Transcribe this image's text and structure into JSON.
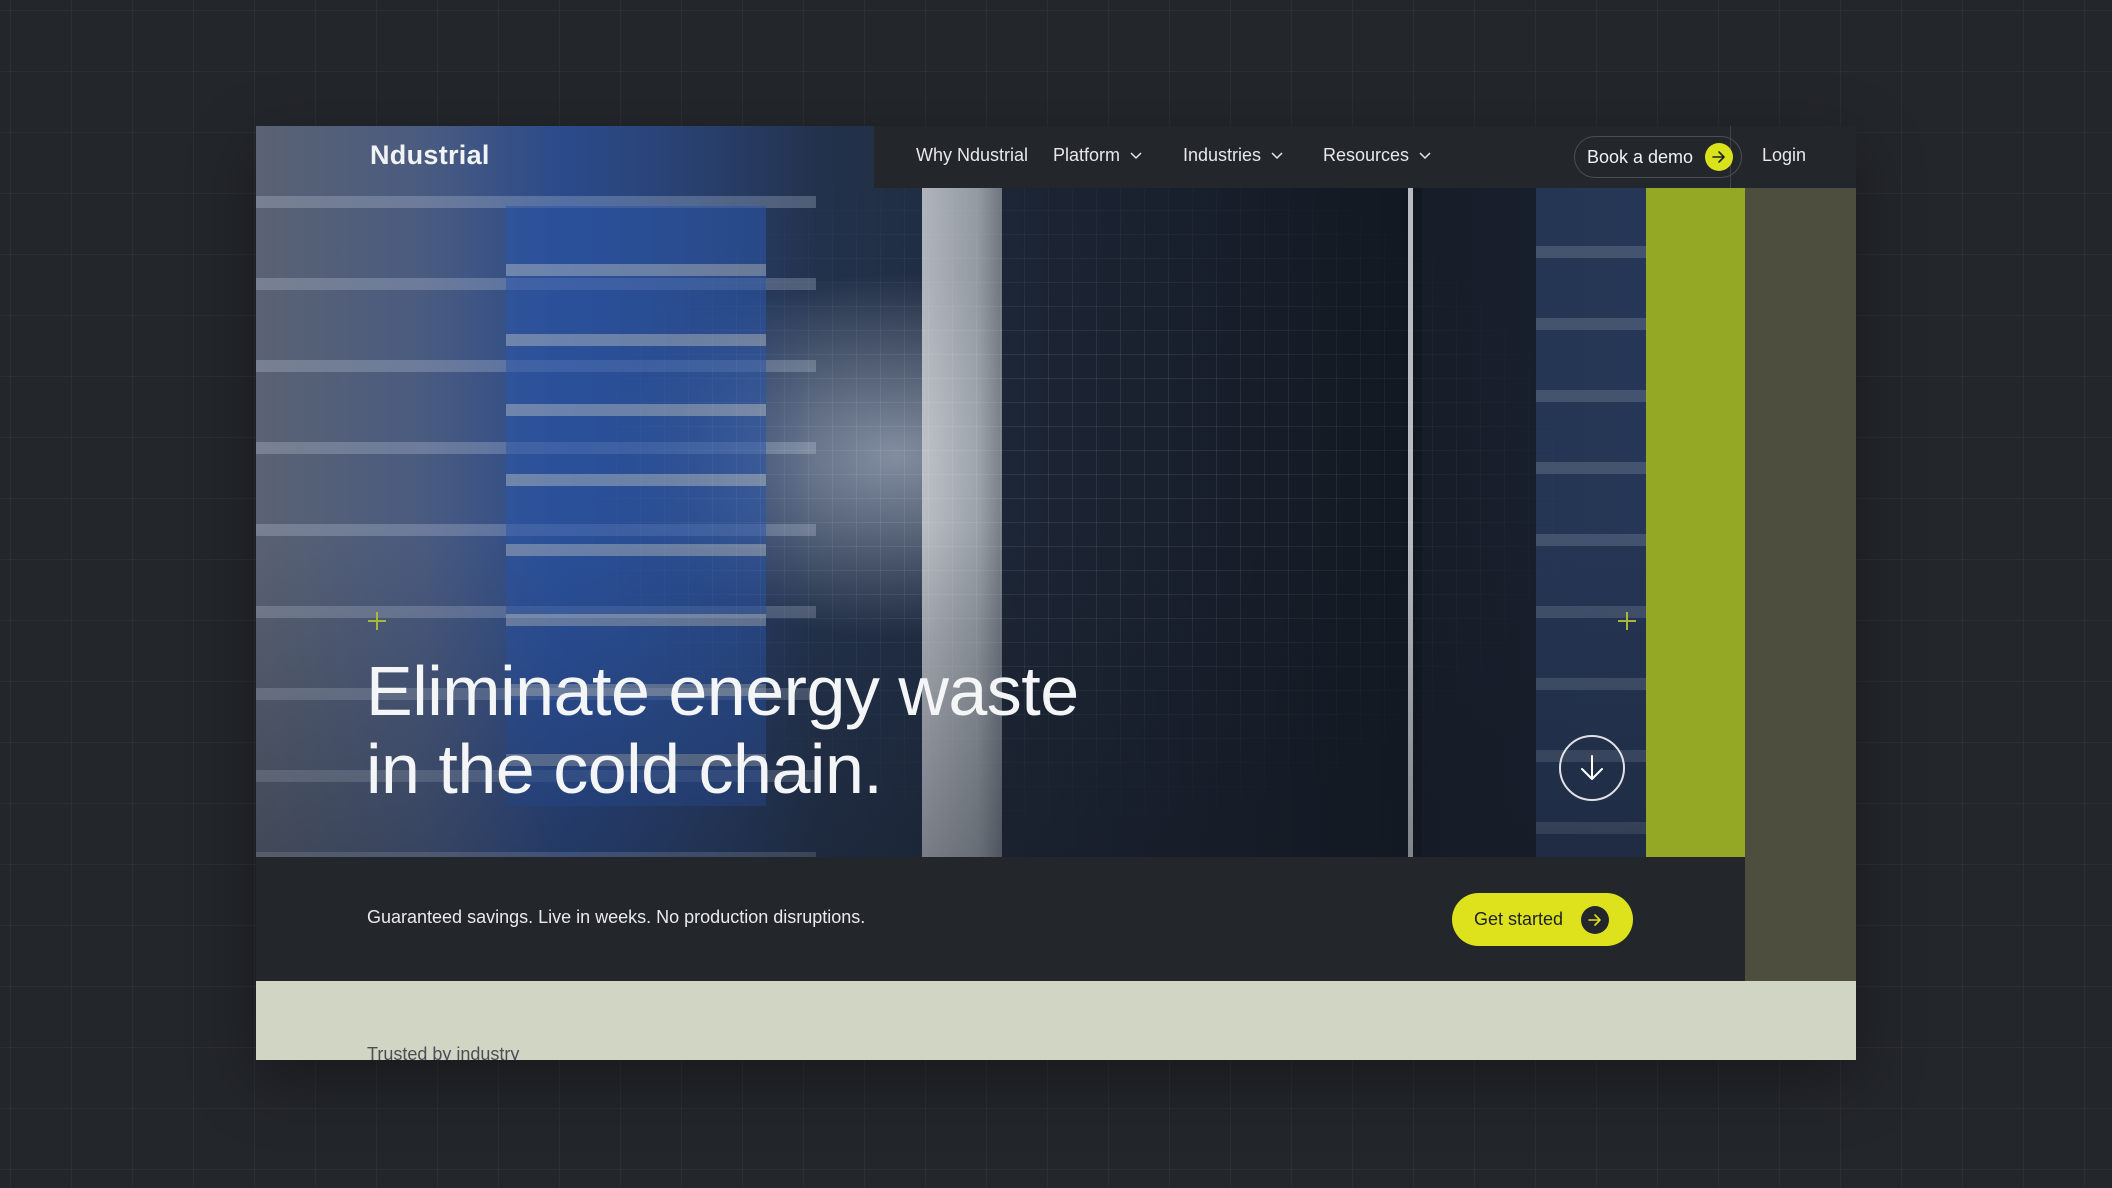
{
  "brand": {
    "logo": "Ndustrial"
  },
  "nav": {
    "items": [
      {
        "label": "Why Ndustrial",
        "has_dropdown": false
      },
      {
        "label": "Platform",
        "has_dropdown": true
      },
      {
        "label": "Industries",
        "has_dropdown": true
      },
      {
        "label": "Resources",
        "has_dropdown": true
      }
    ],
    "login": "Login",
    "cta": "Book a demo"
  },
  "hero": {
    "headline_line1": "Eliminate energy waste",
    "headline_line2": "in the cold chain.",
    "scroll_icon": "arrow-down-icon"
  },
  "cta_bar": {
    "tagline": "Guaranteed savings. Live in weeks. No production disruptions.",
    "button": "Get started"
  },
  "trusted": {
    "label": "Trusted by industry"
  },
  "colors": {
    "accent_yellow": "#dde21c",
    "accent_green": "#94a826",
    "olive": "#4d4e3d",
    "background": "#23262b",
    "band": "#d1d5c4"
  }
}
